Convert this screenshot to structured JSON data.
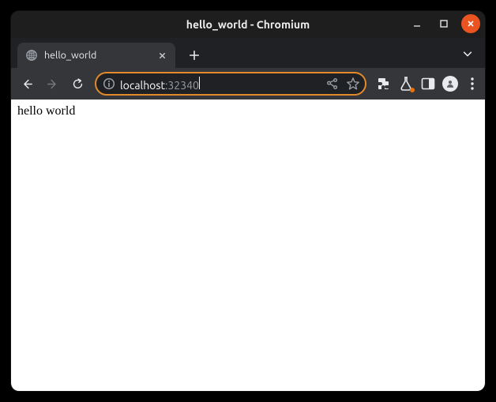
{
  "window": {
    "title": "hello_world - Chromium"
  },
  "tab": {
    "title": "hello_world"
  },
  "url": {
    "host": "localhost",
    "port": ":32340"
  },
  "page": {
    "body": "hello world"
  }
}
